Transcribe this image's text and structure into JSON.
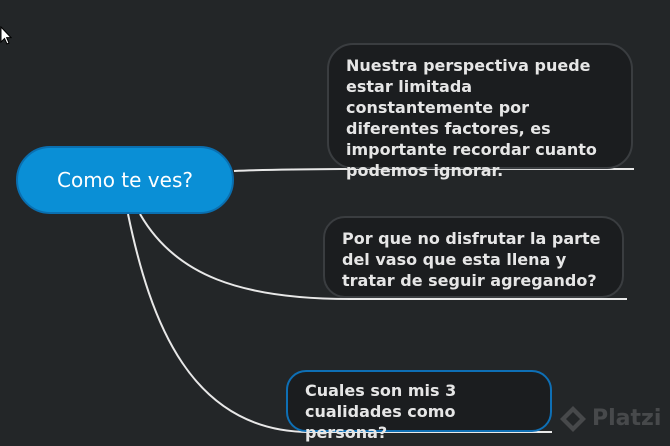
{
  "mindmap": {
    "root": {
      "label": "Como te ves?",
      "color": "#0a8fd6"
    },
    "topics": [
      {
        "text": "Nuestra perspectiva puede estar limitada constantemente por diferentes factores, es importante recordar cuanto podemos ignorar."
      },
      {
        "text": "Por que no disfrutar la parte del vaso que esta llena y tratar de seguir agregando?"
      },
      {
        "text": "Cuales son mis 3 cualidades como persona?",
        "selected": true,
        "accent": "#0e6fb5"
      }
    ],
    "connector_color": "#e8e8e8",
    "background": "#232628"
  },
  "watermark": {
    "text": "Platzi"
  },
  "icons": [
    "mouse-cursor-icon",
    "platzi-logo-icon"
  ]
}
